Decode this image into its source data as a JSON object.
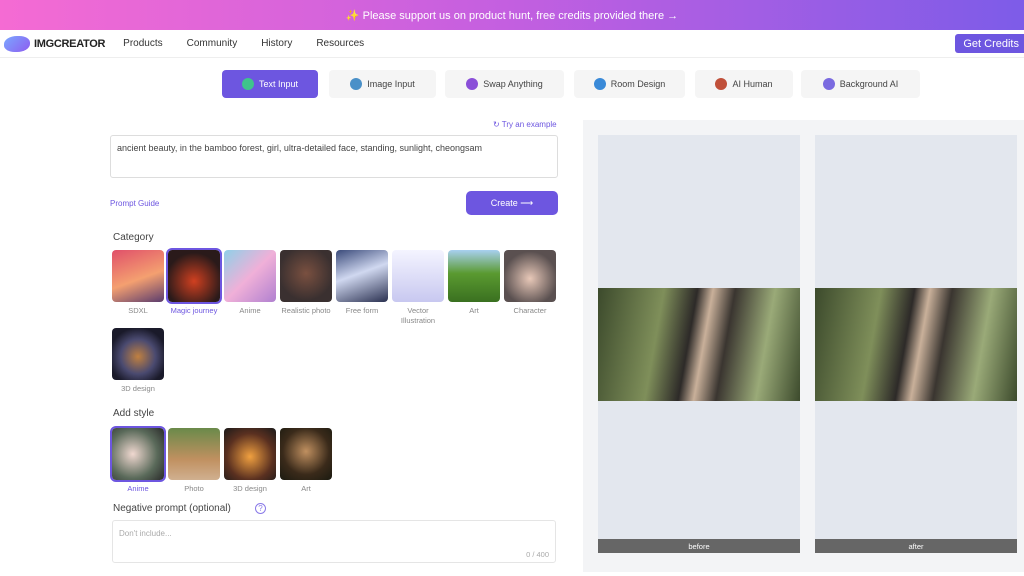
{
  "banner": {
    "text": "✨ Please support us on product hunt, free credits provided there →"
  },
  "nav": {
    "logo": "IMGCREATOR",
    "items": [
      "Products",
      "Community",
      "History",
      "Resources"
    ],
    "get_credits": "Get Credits"
  },
  "tabs": [
    {
      "label": "Text Input",
      "active": true,
      "color": "#3fc48c"
    },
    {
      "label": "Image Input",
      "color": "#4a90c8"
    },
    {
      "label": "Swap Anything",
      "color": "#8a4fd8"
    },
    {
      "label": "Room Design",
      "color": "#3a8ad8"
    },
    {
      "label": "AI Human",
      "color": "#c0503a"
    },
    {
      "label": "Background AI",
      "color": "#7a6ae0"
    }
  ],
  "prompt": {
    "try_example": "Try an example",
    "value": "ancient beauty, in the bamboo forest, girl, ultra-detailed face, standing, sunlight, cheongsam",
    "guide": "Prompt Guide",
    "create": "Create ⟶"
  },
  "category": {
    "title": "Category",
    "items": [
      {
        "label": "SDXL",
        "bg": "linear-gradient(160deg,#e0506a,#f4a070 55%,#5a3c6e)"
      },
      {
        "label": "Magic journey",
        "bg": "radial-gradient(circle at 50% 60%,#d04020,#2a1a1a 70%)",
        "selected": true
      },
      {
        "label": "Anime",
        "bg": "linear-gradient(135deg,#8fd0e8,#f0b0d8 50%,#b080d0)"
      },
      {
        "label": "Realistic photo",
        "bg": "radial-gradient(circle at 50% 45%,#7a5040,#3a3030 70%)"
      },
      {
        "label": "Free form",
        "bg": "linear-gradient(160deg,#3a4a7a,#d0d8f0 45%,#2a3050)"
      },
      {
        "label": "Vector Illustration",
        "bg": "linear-gradient(180deg,#f4f4ff,#c8c8f0)"
      },
      {
        "label": "Art",
        "bg": "linear-gradient(180deg,#a8d0f0,#5a9a30 45%,#3a7020)"
      },
      {
        "label": "Character",
        "bg": "radial-gradient(circle at 50% 55%,#e8c8b8,#5a5050 70%)"
      },
      {
        "label": "3D design",
        "bg": "radial-gradient(circle at 50% 55%,#c08040,#4a4a70 45%,#1a1a2a 75%)"
      }
    ]
  },
  "style": {
    "title": "Add style",
    "items": [
      {
        "label": "Anime",
        "bg": "radial-gradient(circle at 40% 50%,#f0d8d0,#5a6a5a 60%,#2a2a2a)",
        "selected": true
      },
      {
        "label": "Photo",
        "bg": "linear-gradient(180deg,#6a8a4a,#c09060 60%,#d0b090)"
      },
      {
        "label": "3D design",
        "bg": "radial-gradient(circle at 50% 55%,#f0a040,#5a3020 60%,#1a1a1a)"
      },
      {
        "label": "Art",
        "bg": "radial-gradient(circle at 50% 45%,#c09060,#3a2a1a 60%,#1a1a10)"
      }
    ]
  },
  "negative": {
    "title": "Negative prompt (optional)",
    "placeholder": "Don't include...",
    "count": "0 / 400"
  },
  "preview": {
    "before": "before",
    "after": "after"
  }
}
